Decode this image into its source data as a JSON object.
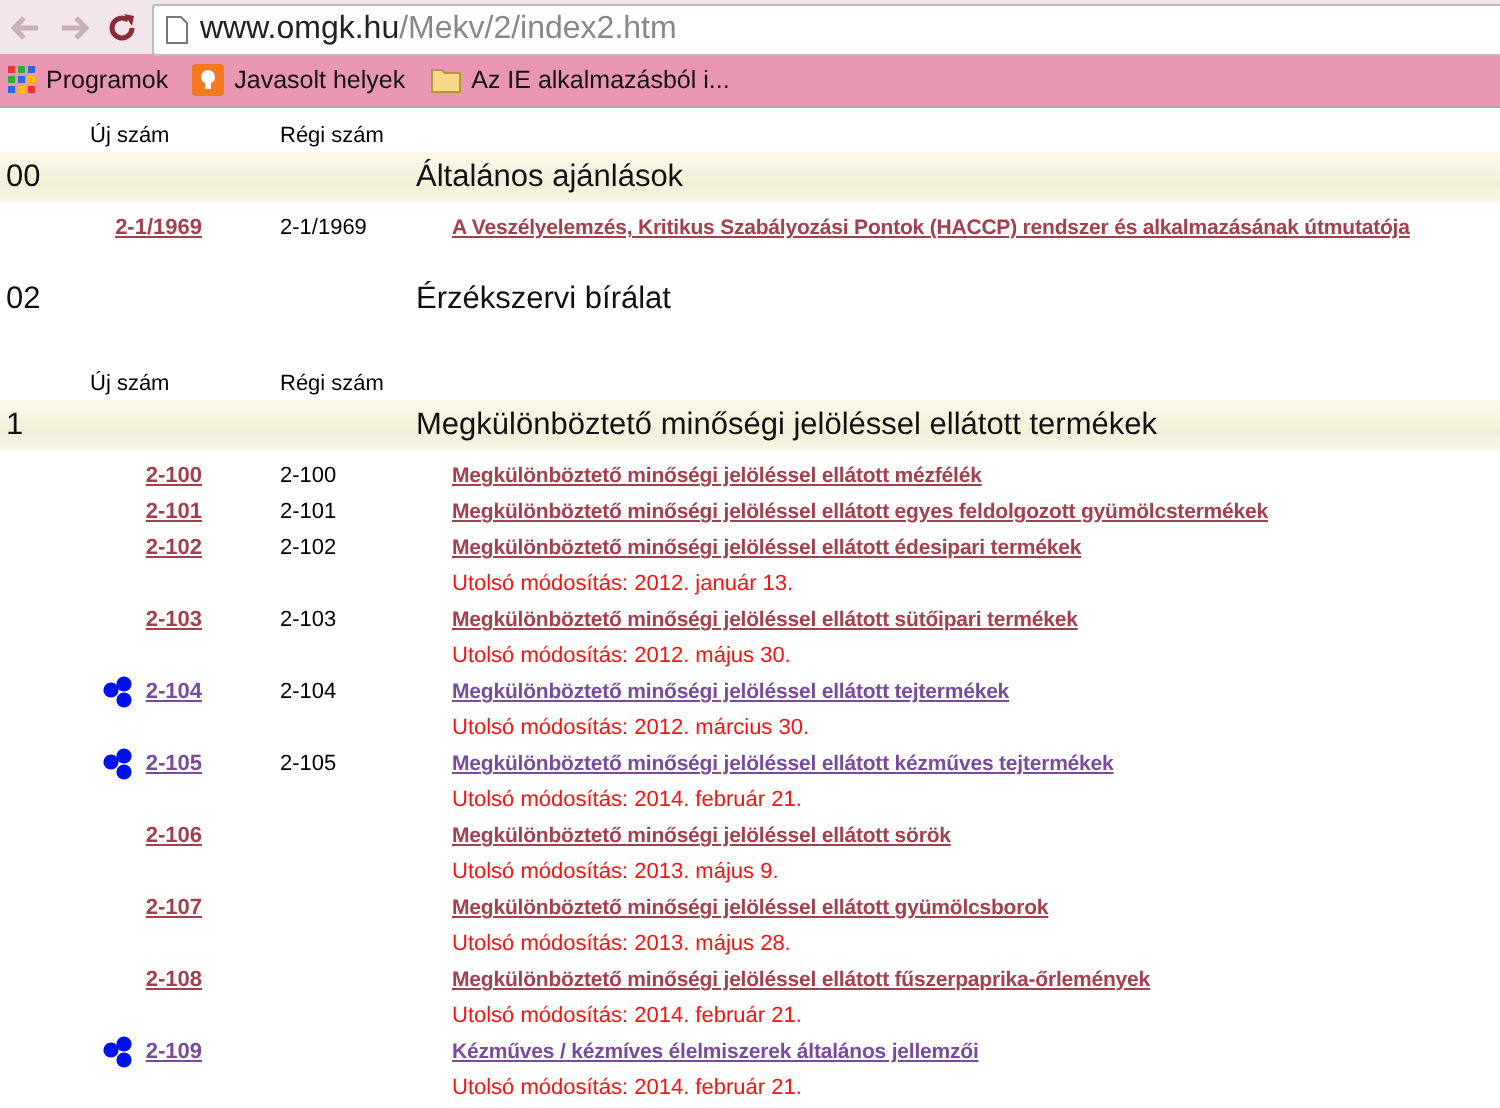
{
  "browser": {
    "url_host": "www.omgk.hu",
    "url_path": "/Mekv/2/index2.htm",
    "bookmarks": [
      {
        "kind": "apps",
        "label": "Programok"
      },
      {
        "kind": "bulb",
        "label": "Javasolt helyek"
      },
      {
        "kind": "folder",
        "label": "Az IE alkalmazásból i..."
      }
    ]
  },
  "sections": [
    {
      "code": "00",
      "title": "Általános ajánlások",
      "banner": true,
      "column_headers": [
        "Új szám",
        "Régi szám"
      ],
      "items": [
        {
          "new_number": "2-1/1969",
          "old_number": "2-1/1969",
          "title": "A Veszélyelemzés, Kritikus Szabályozási Pontok (HACCP) rendszer és alkalmazásának útmutatója",
          "visited": false,
          "marked": false
        }
      ]
    },
    {
      "code": "02",
      "title": "Érzékszervi bírálat",
      "banner": false
    },
    {
      "code": "1",
      "title": "Megkülönböztető minőségi jelöléssel ellátott termékek",
      "banner": true,
      "column_headers": [
        "Új szám",
        "Régi szám"
      ],
      "items": [
        {
          "new_number": "2-100",
          "old_number": "2-100",
          "title": "Megkülönböztető minőségi jelöléssel ellátott mézfélék",
          "visited": false,
          "marked": false
        },
        {
          "new_number": "2-101",
          "old_number": "2-101",
          "title": "Megkülönböztető minőségi jelöléssel ellátott egyes feldolgozott gyümölcstermékek",
          "visited": false,
          "marked": false
        },
        {
          "new_number": "2-102",
          "old_number": "2-102",
          "title": "Megkülönböztető minőségi jelöléssel ellátott édesipari termékek",
          "visited": false,
          "marked": false,
          "modified": "Utolsó módosítás: 2012. január 13."
        },
        {
          "new_number": "2-103",
          "old_number": "2-103",
          "title": "Megkülönböztető minőségi jelöléssel ellátott sütőipari termékek",
          "visited": false,
          "marked": false,
          "modified": "Utolsó módosítás: 2012. május 30."
        },
        {
          "new_number": "2-104",
          "old_number": "2-104",
          "title": "Megkülönböztető minőségi jelöléssel ellátott tejtermékek",
          "visited": true,
          "marked": true,
          "modified": "Utolsó módosítás: 2012. március 30."
        },
        {
          "new_number": "2-105",
          "old_number": "2-105",
          "title": "Megkülönböztető minőségi jelöléssel ellátott kézműves tejtermékek",
          "visited": true,
          "marked": true,
          "modified": "Utolsó módosítás: 2014. február 21."
        },
        {
          "new_number": "2-106",
          "title": "Megkülönböztető minőségi jelöléssel ellátott sörök",
          "visited": false,
          "marked": false,
          "modified": "Utolsó módosítás: 2013. május 9."
        },
        {
          "new_number": "2-107",
          "title": "Megkülönböztető minőségi jelöléssel ellátott gyümölcsborok",
          "visited": false,
          "marked": false,
          "modified": "Utolsó módosítás: 2013. május 28."
        },
        {
          "new_number": "2-108",
          "title": "Megkülönböztető minőségi jelöléssel ellátott fűszerpaprika-őrlemények",
          "visited": false,
          "marked": false,
          "modified": "Utolsó módosítás: 2014. február 21."
        },
        {
          "new_number": "2-109",
          "title": "Kézműves / kézmíves élelmiszerek általános jellemzői",
          "visited": true,
          "marked": true,
          "modified": "Utolsó módosítás: 2014. február 21."
        }
      ]
    }
  ]
}
